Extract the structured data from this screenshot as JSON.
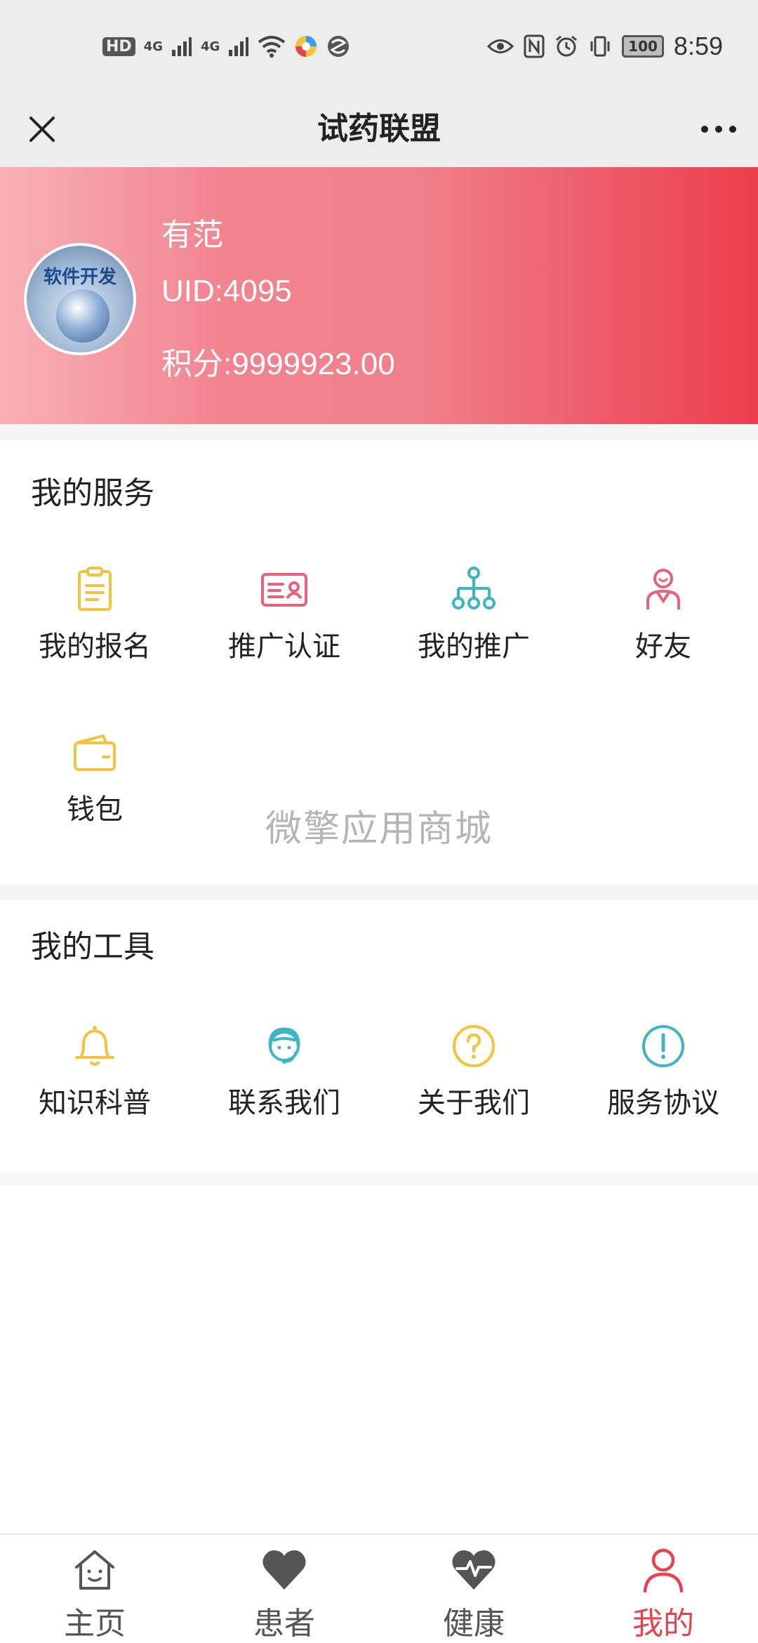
{
  "status_bar": {
    "hd": "HD",
    "sim1": "4G",
    "sim2": "4G",
    "battery": "100",
    "time": "8:59"
  },
  "nav": {
    "title": "试药联盟"
  },
  "profile": {
    "avatar_text": "软件开发",
    "name": "有范",
    "uid": "UID:4095",
    "points": "积分:9999923.00"
  },
  "services": {
    "title": "我的服务",
    "items": [
      {
        "label": "我的报名",
        "icon": "clipboard-icon",
        "color": "#f5c33b"
      },
      {
        "label": "推广认证",
        "icon": "id-card-icon",
        "color": "#e8627c"
      },
      {
        "label": "我的推广",
        "icon": "network-icon",
        "color": "#3bb6c4"
      },
      {
        "label": "好友",
        "icon": "friend-icon",
        "color": "#e8627c"
      },
      {
        "label": "钱包",
        "icon": "wallet-icon",
        "color": "#f5c33b"
      }
    ]
  },
  "watermark": "微擎应用商城",
  "tools": {
    "title": "我的工具",
    "items": [
      {
        "label": "知识科普",
        "icon": "bell-icon",
        "color": "#f5c33b"
      },
      {
        "label": "联系我们",
        "icon": "customer-service-icon",
        "color": "#3bb6c4"
      },
      {
        "label": "关于我们",
        "icon": "question-icon",
        "color": "#f5c33b"
      },
      {
        "label": "服务协议",
        "icon": "info-icon",
        "color": "#3bb6c4"
      }
    ]
  },
  "tab_bar": {
    "items": [
      {
        "label": "主页",
        "icon": "home-icon"
      },
      {
        "label": "患者",
        "icon": "heart-icon"
      },
      {
        "label": "健康",
        "icon": "heartbeat-icon"
      },
      {
        "label": "我的",
        "icon": "person-icon"
      }
    ],
    "active_color": "#e8424f"
  }
}
